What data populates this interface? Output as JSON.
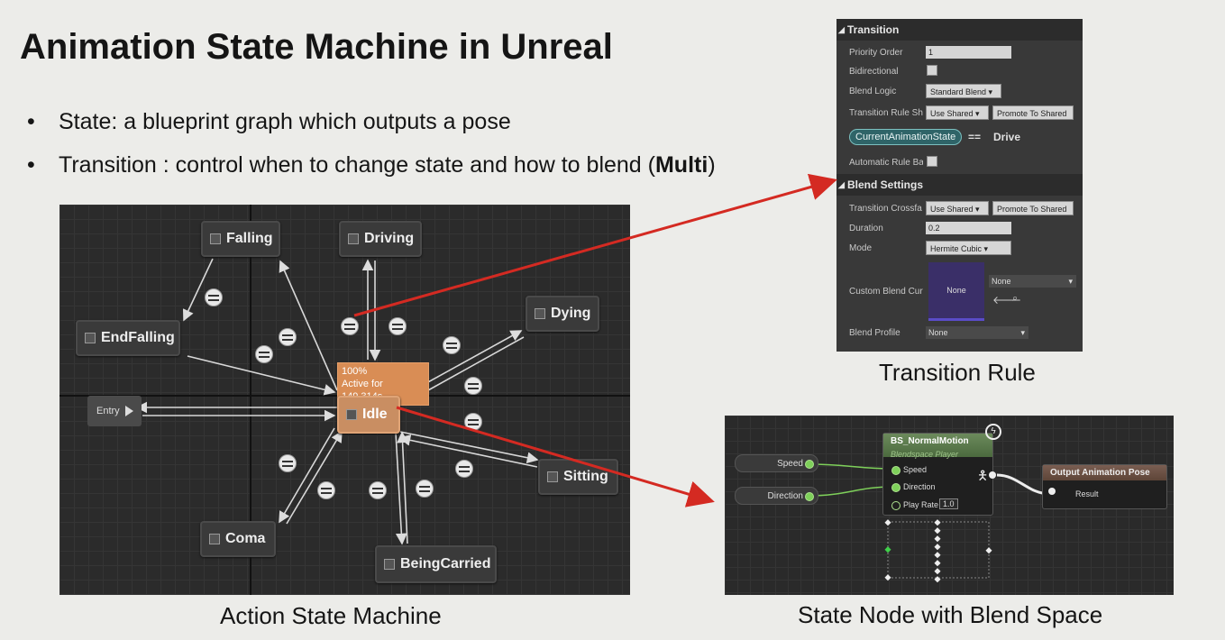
{
  "slide": {
    "title": "Animation State Machine in Unreal",
    "bullets": [
      {
        "text": "State: a blueprint graph which outputs a pose"
      },
      {
        "text_pre": "Transition : control when to change state and how to blend (",
        "bold": "Multi",
        "text_post": ")"
      }
    ],
    "captions": {
      "state_machine": "Action State Machine",
      "transition_rule": "Transition Rule",
      "state_node": "State Node with Blend Space"
    }
  },
  "state_machine": {
    "entry_label": "Entry",
    "idle_tooltip": {
      "line1": "100%",
      "line2": "Active for 149.314s"
    },
    "states": {
      "falling": "Falling",
      "driving": "Driving",
      "endfalling": "EndFalling",
      "dying": "Dying",
      "idle": "Idle",
      "sitting": "Sitting",
      "coma": "Coma",
      "beingcarried": "BeingCarried"
    }
  },
  "details": {
    "transition_header": "Transition",
    "priority_order_label": "Priority Order",
    "priority_order_value": "1",
    "bidirectional_label": "Bidirectional",
    "blend_logic_label": "Blend Logic",
    "blend_logic_value": "Standard Blend",
    "transition_rule_label": "Transition Rule Sha",
    "use_shared": "Use Shared",
    "promote_to_shared": "Promote To Shared",
    "rule_variable": "CurrentAnimationState",
    "rule_operator": "==",
    "rule_value": "Drive",
    "automatic_rule_label": "Automatic Rule Bas",
    "blend_settings_header": "Blend Settings",
    "transition_crossfade_label": "Transition Crossfa",
    "duration_label": "Duration",
    "duration_value": "0.2",
    "mode_label": "Mode",
    "mode_value": "Hermite Cubic",
    "custom_blend_curve_label": "Custom Blend Curv",
    "curve_thumbnail_text": "None",
    "curve_select_value": "None",
    "blend_profile_label": "Blend Profile",
    "blend_profile_value": "None"
  },
  "blend_graph": {
    "speed_var": "Speed",
    "direction_var": "Direction",
    "node_title": "BS_NormalMotion",
    "node_subtitle": "Blendspace Player",
    "pin_speed": "Speed",
    "pin_direction": "Direction",
    "pin_play_rate": "Play Rate",
    "play_rate_value": "1.0",
    "output_title": "Output Animation Pose",
    "output_pin": "Result"
  },
  "colors": {
    "arrow_red": "#d42a22",
    "idle_node": "#c98e62",
    "pill_teal": "#2f6468",
    "pin_green": "#7ed05a"
  }
}
